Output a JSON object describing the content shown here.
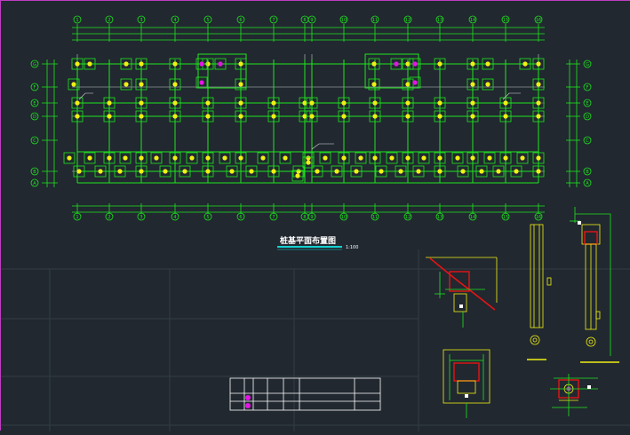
{
  "drawing": {
    "title": "桩基平面布置图",
    "scale": "1:100"
  },
  "axes": {
    "column_labels": [
      "1",
      "2",
      "3",
      "4",
      "5",
      "6",
      "7",
      "8",
      "9",
      "10",
      "11",
      "12",
      "13",
      "14",
      "15",
      "16"
    ],
    "row_labels": [
      "G",
      "F",
      "E",
      "D",
      "C",
      "B",
      "A"
    ]
  },
  "colors": {
    "background": "#212830",
    "grid_green": "#1ee61e",
    "pile_yellow": "#f0f014",
    "marker_magenta": "#e614e6",
    "title_underline": "#14d2d2",
    "frame_magenta": "#c03cc0",
    "detail_red": "#e61414",
    "guide_gray": "#3a434c",
    "axis_white": "#c8c8c8"
  }
}
